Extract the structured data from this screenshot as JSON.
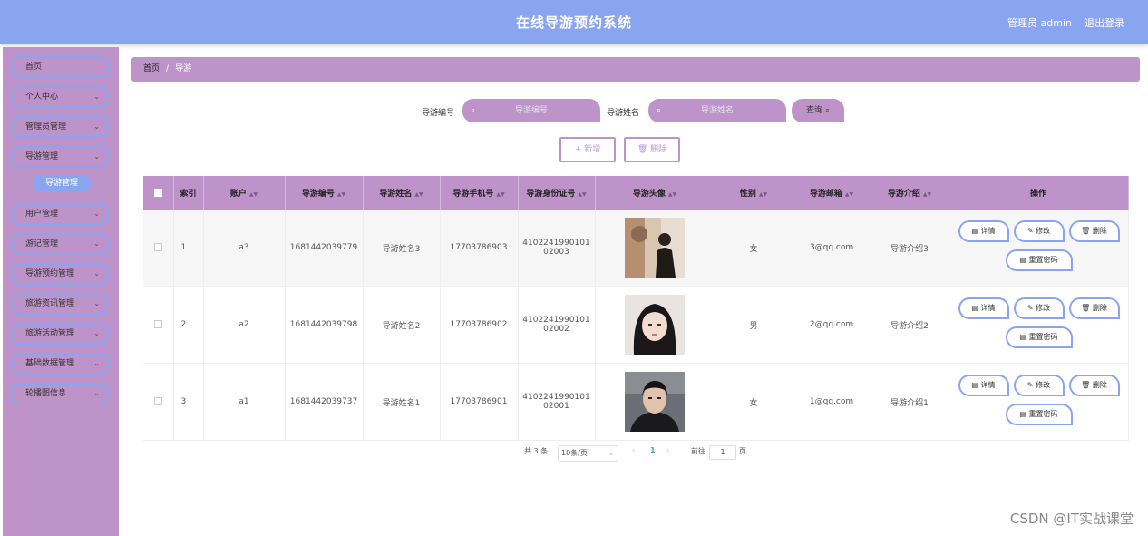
{
  "header": {
    "title": "在线导游预约系统",
    "user": "管理员 admin",
    "logout": "退出登录"
  },
  "sidebar": {
    "items": [
      {
        "label": "首页",
        "chevron": ""
      },
      {
        "label": "个人中心",
        "chevron": "⌄"
      },
      {
        "label": "管理员管理",
        "chevron": "⌄"
      },
      {
        "label": "导游管理",
        "chevron": "⌄"
      },
      {
        "label": "用户管理",
        "chevron": "⌄"
      },
      {
        "label": "游记管理",
        "chevron": "⌄"
      },
      {
        "label": "导游预约管理",
        "chevron": "⌄"
      },
      {
        "label": "旅游资讯管理",
        "chevron": "⌄"
      },
      {
        "label": "旅游活动管理",
        "chevron": "⌄"
      },
      {
        "label": "基础数据管理",
        "chevron": "⌄"
      },
      {
        "label": "轮播图信息",
        "chevron": "⌄"
      }
    ],
    "sub_item": "导游管理"
  },
  "breadcrumb": {
    "home": "首页",
    "separator": "/",
    "current": "导游"
  },
  "search": {
    "code_label": "导游编号",
    "code_placeholder": "导游编号",
    "name_label": "导游姓名",
    "name_placeholder": "导游姓名",
    "button": "查询"
  },
  "actions": {
    "add": "+ 新增",
    "delete": "删除"
  },
  "table": {
    "headers": [
      "索引",
      "账户",
      "导游编号",
      "导游姓名",
      "导游手机号",
      "导游身份证号",
      "导游头像",
      "性别",
      "导游邮箱",
      "导游介绍",
      "操作"
    ],
    "rows": [
      {
        "index": "1",
        "account": "a3",
        "code": "1681442039779",
        "name": "导游姓名3",
        "phone": "17703786903",
        "id_card_1": "4102241990101",
        "id_card_2": "02003",
        "gender": "女",
        "email": "3@qq.com",
        "intro": "导游介绍3"
      },
      {
        "index": "2",
        "account": "a2",
        "code": "1681442039798",
        "name": "导游姓名2",
        "phone": "17703786902",
        "id_card_1": "4102241990101",
        "id_card_2": "02002",
        "gender": "男",
        "email": "2@qq.com",
        "intro": "导游介绍2"
      },
      {
        "index": "3",
        "account": "a1",
        "code": "1681442039737",
        "name": "导游姓名1",
        "phone": "17703786901",
        "id_card_1": "4102241990101",
        "id_card_2": "02001",
        "gender": "女",
        "email": "1@qq.com",
        "intro": "导游介绍1"
      }
    ],
    "row_ops": {
      "detail": "详情",
      "edit": "修改",
      "delete": "删除",
      "reset": "重置密码"
    }
  },
  "pagination": {
    "total": "共 3 条",
    "page_size": "10条/页",
    "prev": "‹",
    "current": "1",
    "next": "›",
    "goto": "前往",
    "goto_value": "1",
    "page_unit": "页"
  },
  "watermark": "CSDN @IT实战课堂",
  "colors": {
    "header": "#8aa5f0",
    "accent": "#bd93c9"
  }
}
